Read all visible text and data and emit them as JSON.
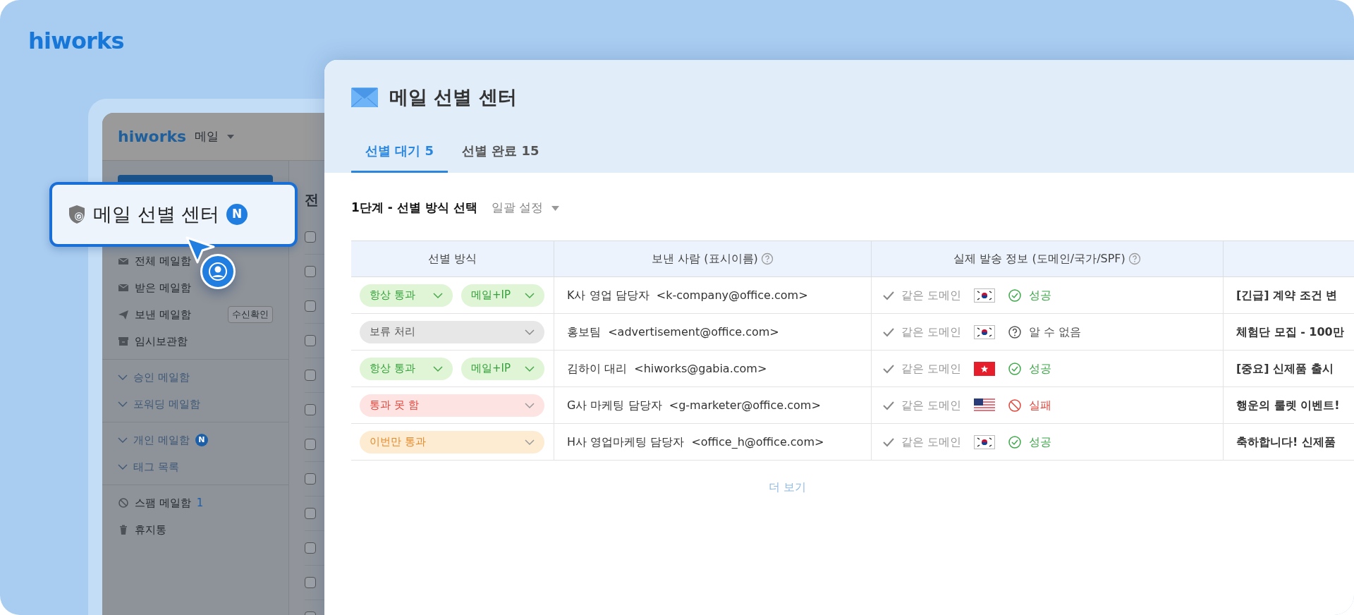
{
  "brand": "hiworks",
  "background_app": {
    "brand": "hiworks",
    "app_menu": "메일",
    "content_title": "전",
    "list_rows": [
      {
        "checked": false
      },
      {
        "checked": false
      },
      {
        "checked": false
      },
      {
        "checked": false
      },
      {
        "checked": false
      },
      {
        "checked": false
      },
      {
        "checked": false
      },
      {
        "checked": false
      },
      {
        "checked": false
      },
      {
        "checked": false
      },
      {
        "checked": false
      },
      {
        "checked": false
      }
    ],
    "sidebar_sections": [
      [
        {
          "label": "전체 메일함"
        },
        {
          "label": "받은 메일함"
        },
        {
          "label": "보낸 메일함",
          "tag": "수신확인"
        },
        {
          "label": "임시보관함"
        }
      ],
      [
        {
          "label": "승인 메일함",
          "kind": "group"
        },
        {
          "label": "포워딩 메일함",
          "kind": "group"
        }
      ],
      [
        {
          "label": "개인 메일함",
          "kind": "group",
          "badge": "N"
        },
        {
          "label": "태그 목록",
          "kind": "group"
        }
      ],
      [
        {
          "label": "스팸 메일함",
          "count": "1"
        },
        {
          "label": "휴지통"
        }
      ]
    ]
  },
  "callout": {
    "label": "메일 선별 센터",
    "badge": "N"
  },
  "panel": {
    "title": "메일 선별 센터",
    "tabs": [
      {
        "label": "선별 대기",
        "count": "5",
        "selected": true
      },
      {
        "label": "선별 완료",
        "count": "15",
        "selected": false
      }
    ],
    "step_title": "1단계 - 선별 방식 선택",
    "bulk_setting": "일괄 설정",
    "table": {
      "columns": [
        {
          "label": "선별 방식",
          "help": false
        },
        {
          "label": "보낸 사람 (표시이름)",
          "help": true
        },
        {
          "label": "실제 발송 정보 (도메인/국가/SPF)",
          "help": true
        }
      ],
      "rows": [
        {
          "method": {
            "label": "항상 통과",
            "kind": "pass"
          },
          "scope": "메일+IP",
          "sender_name": "K사 영업 담당자",
          "sender_email": "<k-company@office.com>",
          "domain_check": "같은 도메인",
          "country_flag": {
            "kind": "kr"
          },
          "spf": {
            "label": "성공",
            "kind": "success"
          },
          "subject": "[긴급] 계약 조건 변"
        },
        {
          "method": {
            "label": "보류 처리",
            "kind": "hold"
          },
          "sender_name": "홍보팀",
          "sender_email": "<advertisement@office.com>",
          "domain_check": "같은 도메인",
          "country_flag": {
            "kind": "kr"
          },
          "spf": {
            "label": "알 수 없음",
            "kind": "unknown"
          },
          "subject": "체험단 모집 - 100만"
        },
        {
          "method": {
            "label": "항상 통과",
            "kind": "pass"
          },
          "scope": "메일+IP",
          "sender_name": "김하이 대리",
          "sender_email": "<hiworks@gabia.com>",
          "domain_check": "같은 도메인",
          "country_flag": {
            "kind": "hk"
          },
          "spf": {
            "label": "성공",
            "kind": "success"
          },
          "subject": "[중요] 신제품 출시"
        },
        {
          "method": {
            "label": "통과 못 함",
            "kind": "block"
          },
          "sender_name": "G사 마케팅 담당자",
          "sender_email": "<g-marketer@office.com>",
          "domain_check": "같은 도메인",
          "country_flag": {
            "kind": "us"
          },
          "spf": {
            "label": "실패",
            "kind": "fail"
          },
          "subject": "행운의 룰렛 이벤트!"
        },
        {
          "method": {
            "label": "이번만 통과",
            "kind": "once"
          },
          "sender_name": "H사 영업마케팅 담당자",
          "sender_email": "<office_h@office.com>",
          "domain_check": "같은 도메인",
          "country_flag": {
            "kind": "kr"
          },
          "spf": {
            "label": "성공",
            "kind": "success"
          },
          "subject": "축하합니다! 신제품"
        }
      ]
    },
    "more_button": "더 보기"
  }
}
